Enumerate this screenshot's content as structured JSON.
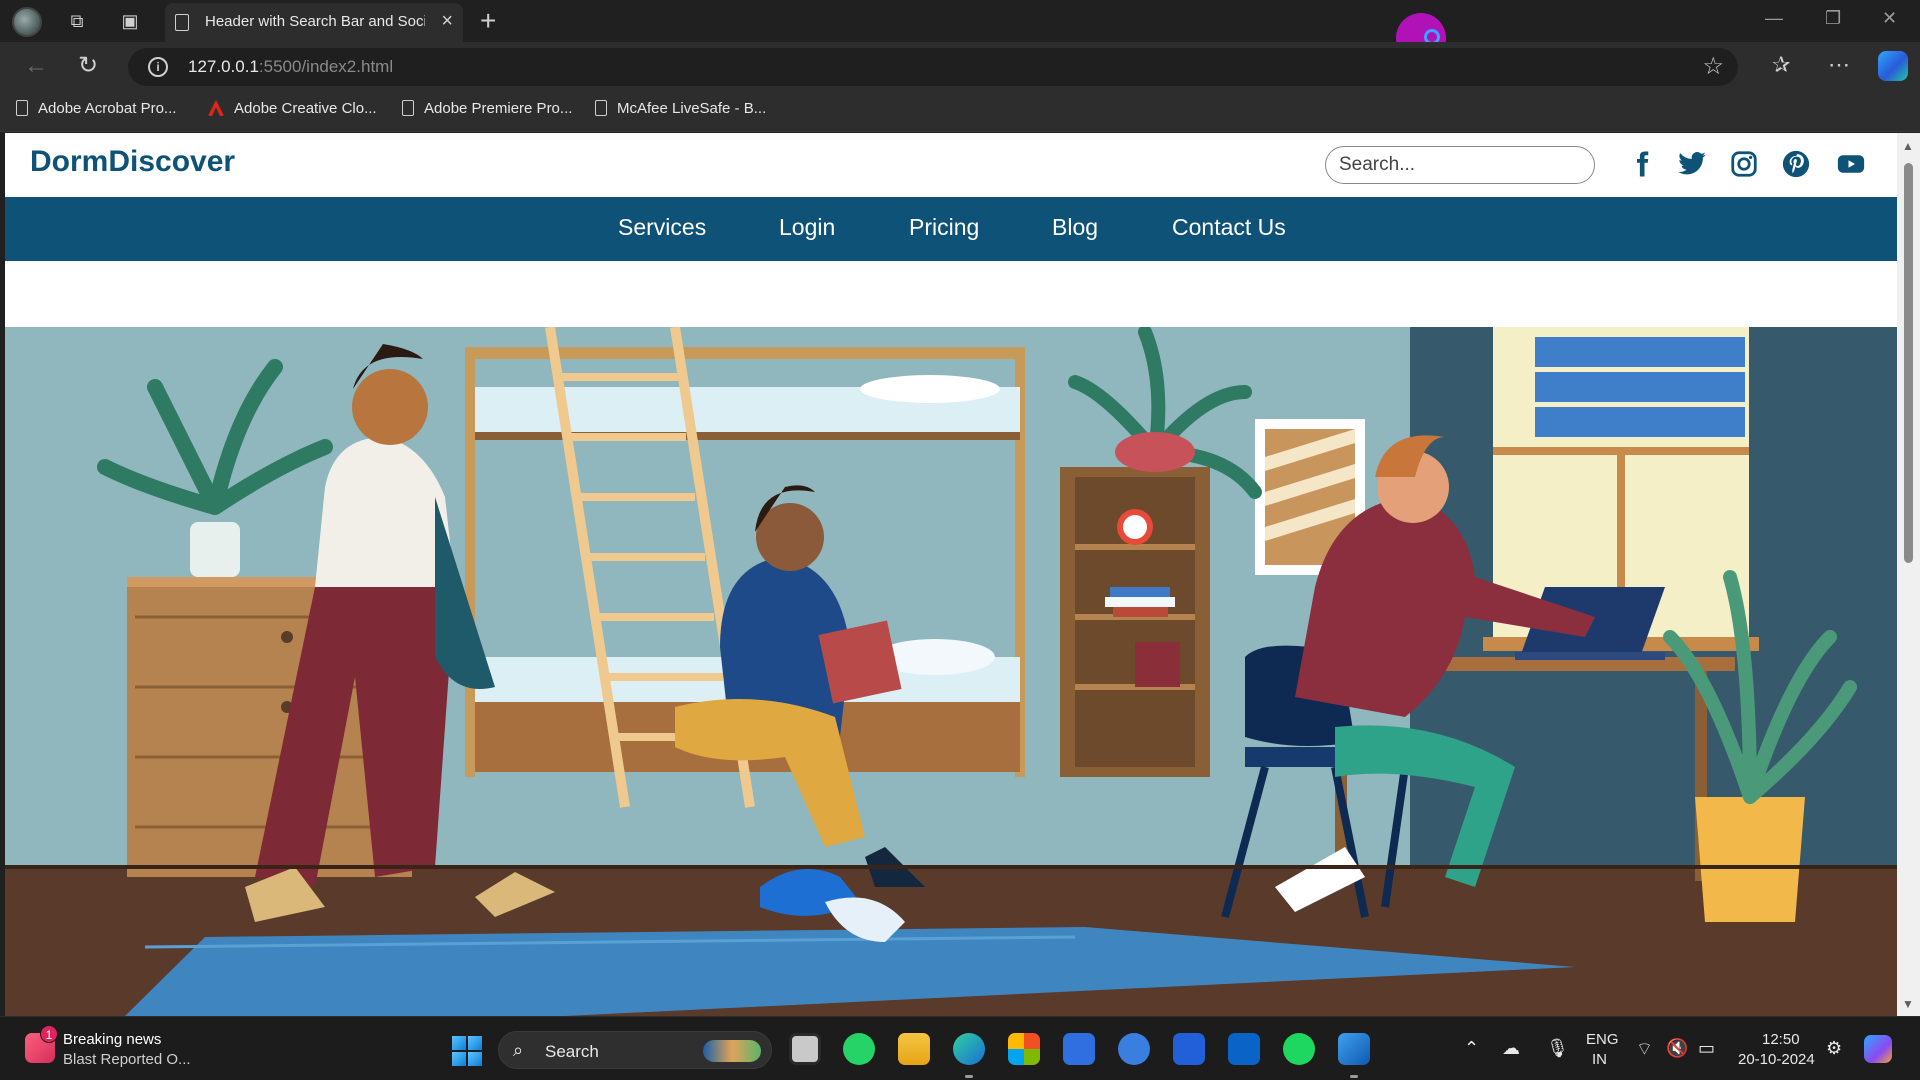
{
  "browser": {
    "tab_title": "Header with Search Bar and Social",
    "url_host": "127.0.0.1",
    "url_path": ":5500/index2.html",
    "bookmarks": [
      {
        "label": "Adobe Acrobat Pro..."
      },
      {
        "label": "Adobe Creative Clo..."
      },
      {
        "label": "Adobe Premiere Pro..."
      },
      {
        "label": "McAfee LiveSafe - B..."
      }
    ]
  },
  "site": {
    "logo": "DormDiscover",
    "search_placeholder": "Search...",
    "social_icons": [
      "facebook-icon",
      "twitter-icon",
      "instagram-icon",
      "pinterest-icon",
      "youtube-icon"
    ],
    "nav": [
      {
        "label": "Services"
      },
      {
        "label": "Login"
      },
      {
        "label": "Pricing"
      },
      {
        "label": "Blog"
      },
      {
        "label": "Contact Us"
      }
    ],
    "colors": {
      "brand": "#0f5278",
      "nav_bg": "#0f5278"
    }
  },
  "taskbar": {
    "news_title": "Breaking news",
    "news_subtitle": "Blast Reported O...",
    "news_badge": "1",
    "search_label": "Search",
    "lang_line1": "ENG",
    "lang_line2": "IN",
    "time": "12:50",
    "date": "20-10-2024"
  }
}
